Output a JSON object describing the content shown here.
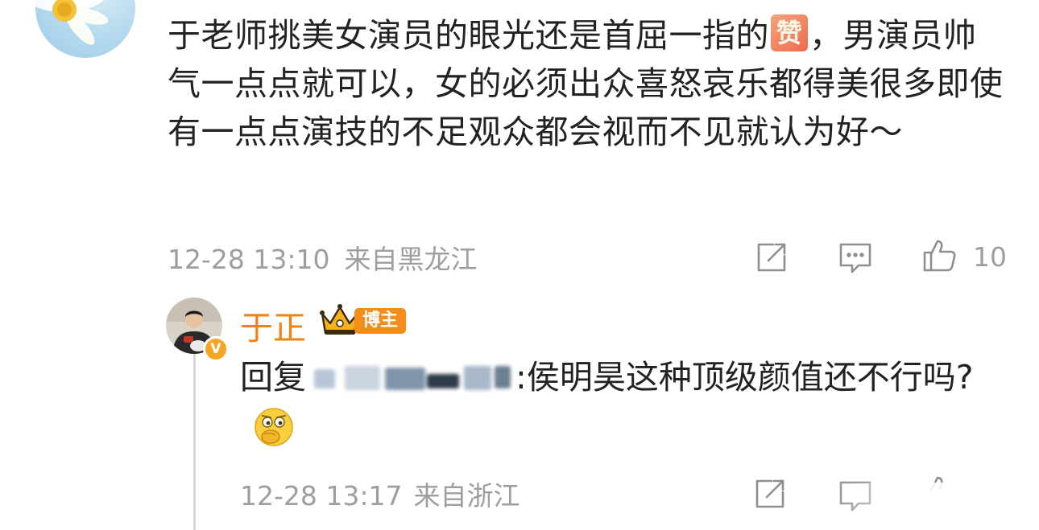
{
  "parent_comment": {
    "text_part1": "于老师挑美女演员的眼光还是首屈一指的",
    "inline_emoji": "赞",
    "text_part2": "，男演员帅气一点点就可以，女的必须出众喜怒哀乐都得美很多即使有一点点演技的不足观众都会视而不见就认为好～",
    "date": "12-28 13:10",
    "location": "来自黑龙江",
    "like_count": "10",
    "icons": [
      "share-icon",
      "comment-icon",
      "like-icon"
    ]
  },
  "reply": {
    "author_name": "于正",
    "author_badge": "博主",
    "verify_mark": "V",
    "reply_prefix": "回复",
    "reply_body": ":侯明昊这种顶级颜值还不行吗?",
    "date": "12-28 13:17",
    "location": "来自浙江",
    "icons": [
      "share-icon",
      "comment-icon",
      "like-icon",
      "crown-icon",
      "thinking-emoji-icon"
    ]
  },
  "colors": {
    "text": "#222222",
    "meta": "#9e9e9e",
    "author_orange": "#f08318",
    "badge_orange": "#f58c1e",
    "thread_line": "#d6d6d6"
  }
}
